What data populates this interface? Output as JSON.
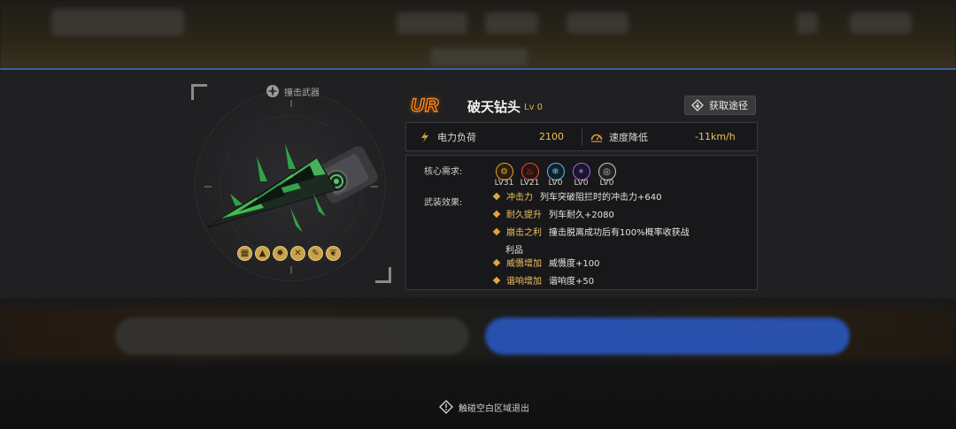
{
  "weapon": {
    "type_label": "撞击武器",
    "rarity": "UR",
    "name": "破天钻头",
    "level": "Lv 0",
    "acquire_label": "获取途径",
    "stats": [
      {
        "label": "电力负荷",
        "value": "2100",
        "icon": "lightning-icon"
      },
      {
        "label": "速度降低",
        "value": "-11km/h",
        "icon": "speedometer-icon"
      }
    ],
    "core_label": "核心需求:",
    "core_requirements": [
      {
        "icon": "power-core-icon",
        "level": "LV31",
        "color": "#e8a030"
      },
      {
        "icon": "fire-core-icon",
        "level": "LV21",
        "color": "#e0503a"
      },
      {
        "icon": "ice-core-icon",
        "level": "LV0",
        "color": "#6ab8e8"
      },
      {
        "icon": "electric-core-icon",
        "level": "LV0",
        "color": "#9a6ae0"
      },
      {
        "icon": "neutral-core-icon",
        "level": "LV0",
        "color": "#c8c8c8"
      }
    ],
    "effects_label": "武装效果:",
    "effects": [
      {
        "name": "冲击力",
        "desc": "列车突破阻拦时的冲击力+640"
      },
      {
        "name": "耐久提升",
        "desc": "列车耐久+2080"
      },
      {
        "name": "崩击之利",
        "desc": "撞击脱离成功后有100%概率收获战",
        "cont": "利品"
      },
      {
        "name": "威慑增加",
        "desc": "威慑度+100"
      },
      {
        "name": "谐响增加",
        "desc": "谐响度+50"
      }
    ],
    "mod_icons": [
      "cart-mod-icon",
      "terrain-mod-icon",
      "gear-mod-icon",
      "crossed-tools-mod-icon",
      "wrench-mod-icon",
      "leaf-mod-icon"
    ]
  },
  "exit_hint": "触碰空白区域退出",
  "colors": {
    "accent_blue": "#3e5ea8",
    "gold": "#f0c060",
    "rarity_orange": "#ff8a1e"
  }
}
